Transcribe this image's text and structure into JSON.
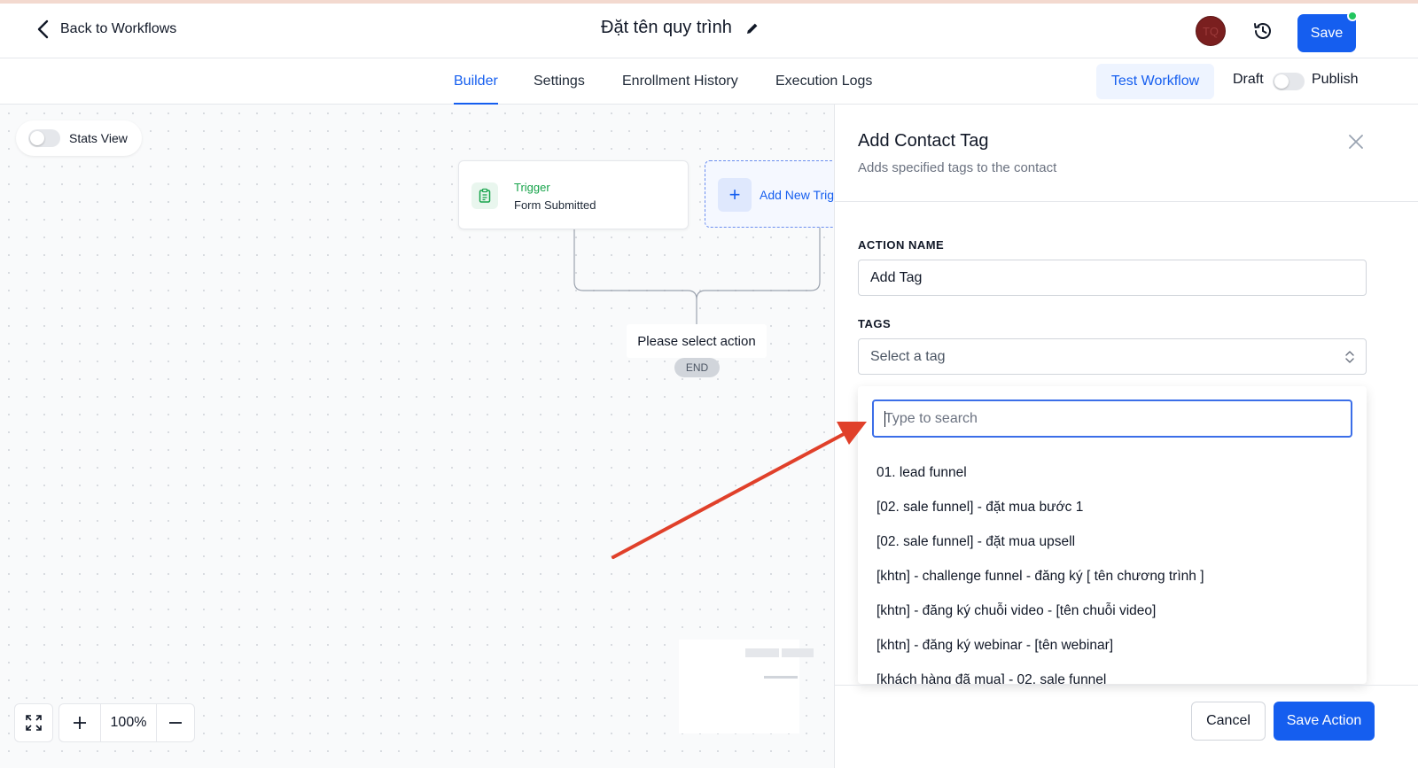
{
  "header": {
    "back_label": "Back to Workflows",
    "title": "Đặt tên quy trình",
    "avatar_initials": "TQ",
    "save_label": "Save"
  },
  "tabs": [
    {
      "label": "Builder",
      "active": true
    },
    {
      "label": "Settings",
      "active": false
    },
    {
      "label": "Enrollment History",
      "active": false
    },
    {
      "label": "Execution Logs",
      "active": false
    }
  ],
  "toolbar": {
    "test_label": "Test Workflow",
    "draft_label": "Draft",
    "publish_label": "Publish",
    "publish_on": false
  },
  "canvas": {
    "stats_label": "Stats View",
    "stats_on": false,
    "trigger": {
      "label": "Trigger",
      "subtitle": "Form Submitted"
    },
    "add_trigger_label": "Add New Trig",
    "select_action_label": "Please select action",
    "end_label": "END",
    "zoom_level": "100%"
  },
  "panel": {
    "title": "Add Contact Tag",
    "subtitle": "Adds specified tags to the contact",
    "action_name_label": "ACTION NAME",
    "action_name_value": "Add Tag",
    "tags_label": "TAGS",
    "tags_placeholder": "Select a tag",
    "search_placeholder": "Type to search",
    "options": [
      "01. lead funnel",
      "[02. sale funnel] - đặt mua bước 1",
      "[02. sale funnel] - đặt mua upsell",
      "[khtn] - challenge funnel - đăng ký [ tên chương trình ]",
      "[khtn] - đăng ký chuỗi video - [tên chuỗi video]",
      "[khtn] - đăng ký webinar - [tên webinar]",
      "[khách hàng đã mua] - 02. sale funnel"
    ],
    "cancel_label": "Cancel",
    "save_action_label": "Save Action"
  },
  "colors": {
    "primary": "#155eef",
    "trigger_green": "#16a34a",
    "annotation_arrow": "#e0402a",
    "status_dot": "#22c55e"
  },
  "icons": [
    "chevron-left-icon",
    "pencil-icon",
    "history-icon",
    "clipboard-icon",
    "plus-icon",
    "close-icon",
    "expand-icon",
    "minus-icon",
    "updown-chevron-icon"
  ]
}
